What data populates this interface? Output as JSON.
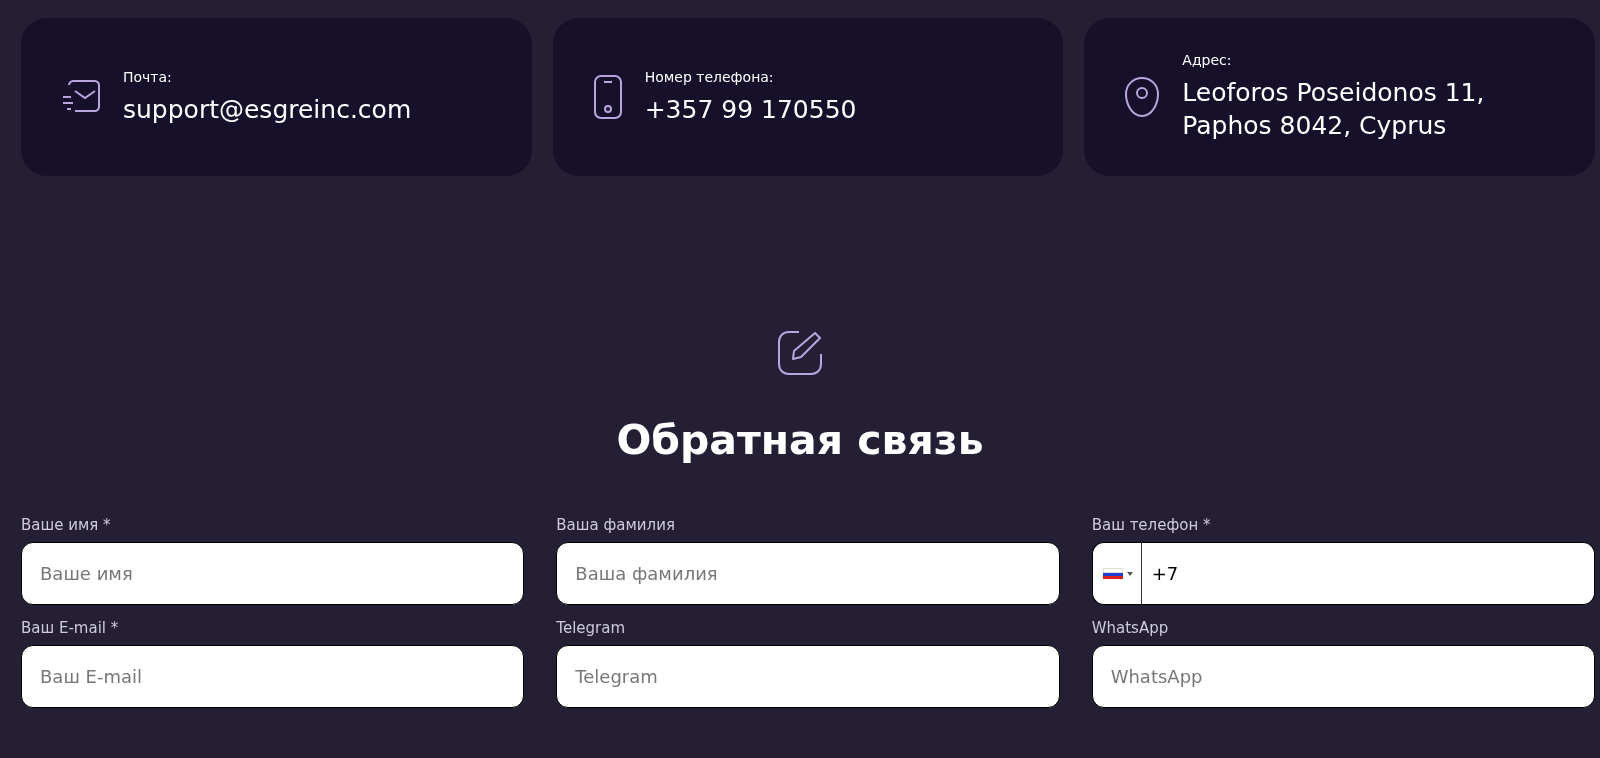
{
  "contacts": [
    {
      "kind": "email",
      "label": "Почта:",
      "value": "support@esgreinc.com"
    },
    {
      "kind": "phone",
      "label": "Номер телефона:",
      "value": "+357 99 170550"
    },
    {
      "kind": "address",
      "label": "Адрес:",
      "value": "Leoforos Poseidonos 11, Paphos 8042, Cyprus"
    }
  ],
  "feedback": {
    "title": "Обратная связь",
    "fields": [
      {
        "kind": "text",
        "label": "Ваше имя *",
        "placeholder": "Ваше имя"
      },
      {
        "kind": "text",
        "label": "Ваша фамилия",
        "placeholder": "Ваша фамилия"
      },
      {
        "kind": "phone",
        "label": "Ваш телефон *",
        "value": "+7"
      },
      {
        "kind": "text",
        "label": "Ваш E-mail *",
        "placeholder": "Ваш E-mail"
      },
      {
        "kind": "text",
        "label": "Telegram",
        "placeholder": "Telegram"
      },
      {
        "kind": "text",
        "label": "WhatsApp",
        "placeholder": "WhatsApp"
      }
    ]
  }
}
